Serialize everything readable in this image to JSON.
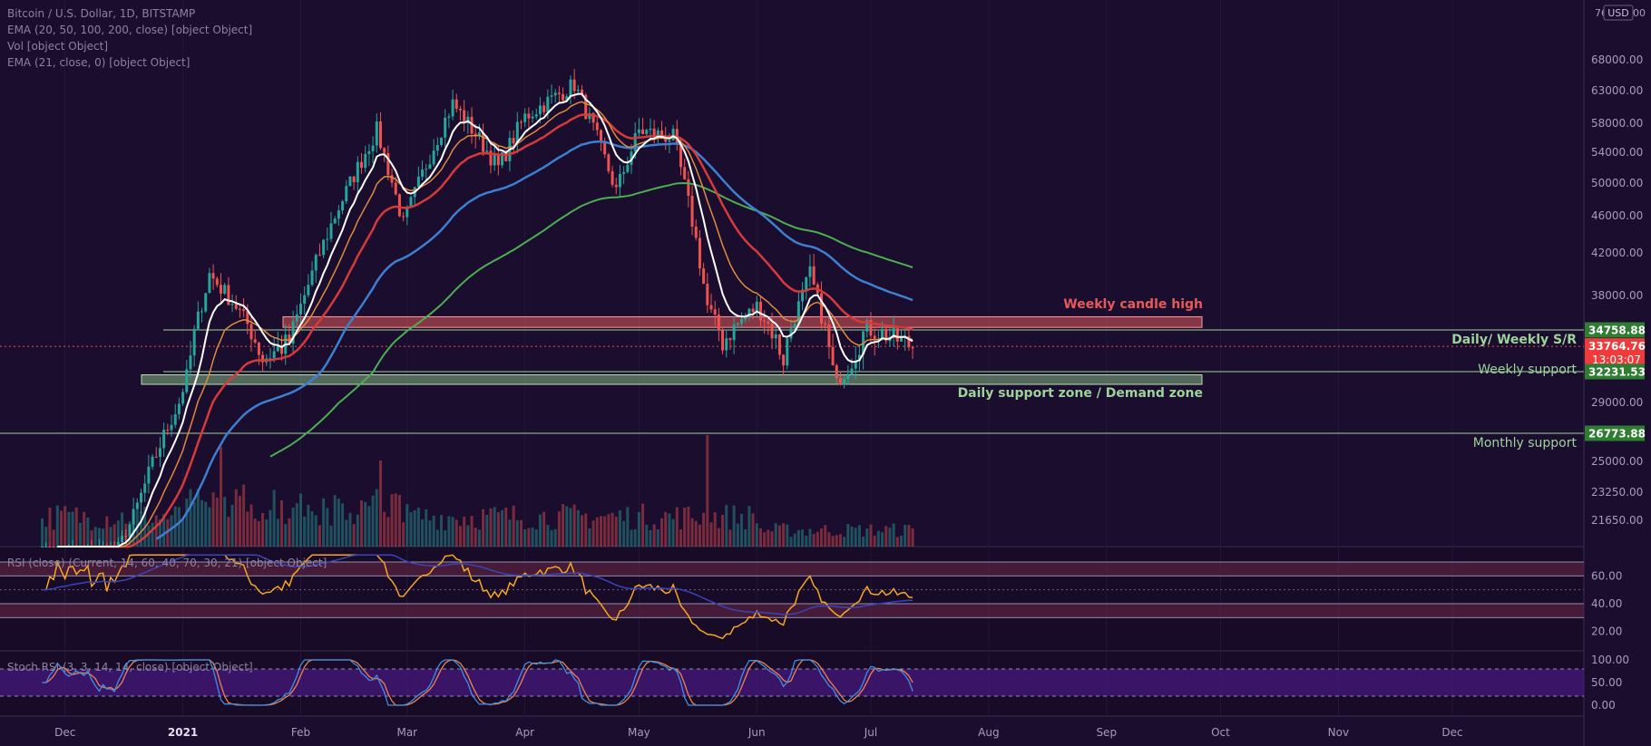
{
  "header": {
    "symbol_line": "Bitcoin / U.S. Dollar, 1D, BITSTAMP",
    "ema_line": "EMA (20, 50, 100, 200, close) [object Object]",
    "vol_line": "Vol [object Object]",
    "ema2_line": "EMA (21, close, 0) [object Object]",
    "rsi_line": "RSI (close) (Current, 14, 60, 40, 70, 30, 21) [object Object]",
    "stoch_line": "Stoch RSI (3, 3, 14, 14, close) [object Object]"
  },
  "currency": "USD",
  "price_axis": {
    "ticks": [
      "68000.00",
      "63000.00",
      "58000.00",
      "54000.00",
      "50000.00",
      "46000.00",
      "42000.00",
      "38000.00",
      "34758.88",
      "33764.76",
      "32231.53",
      "29000.00",
      "26773.88",
      "25000.00",
      "23250.00",
      "21650.00"
    ],
    "top_partial": "76 000.00"
  },
  "rsi_axis": {
    "ticks": [
      "60.00",
      "40.00",
      "20.00"
    ]
  },
  "stoch_axis": {
    "ticks": [
      "100.00",
      "50.00",
      "0.00"
    ]
  },
  "time_axis": {
    "ticks": [
      "Dec",
      "2021",
      "Feb",
      "Mar",
      "Apr",
      "May",
      "Jun",
      "Jul",
      "Aug",
      "Sep",
      "Oct",
      "Nov",
      "Dec"
    ]
  },
  "price_labels": {
    "last_price": "33764.76",
    "countdown": "13:03:07",
    "sr_level": "34758.88",
    "weekly_support": "32231.53",
    "monthly_support": "26773.88"
  },
  "annotations": {
    "weekly_candle_high": "Weekly candle high",
    "daily_weekly_sr": "Daily/ Weekly S/R",
    "weekly_support": "Weekly support",
    "daily_support_zone": "Daily support zone / Demand zone",
    "monthly_support": "Monthly support"
  },
  "colors": {
    "background": "#1a0d2e",
    "bull_candle": "#26a69a",
    "bear_candle": "#ef5350",
    "ema20": "#ffffff",
    "ema50": "#e08a3c",
    "ema100": "#d63a3a",
    "ema200": "#3d7fd0",
    "ema_long": "#4caf50",
    "weekly_candle_high_zone": "#e05a5a",
    "support_zone": "#8ec58a",
    "rsi_line": "#f5a623",
    "stoch_k": "#3d8fe0",
    "stoch_d": "#f0804a"
  },
  "chart_data": {
    "type": "candlestick",
    "x_range": [
      "Nov 2020",
      "Dec 2021"
    ],
    "ylim": [
      19500,
      76000
    ],
    "levels": {
      "weekly_candle_high_zone": [
        35000,
        36000
      ],
      "sr_level": 34758.88,
      "last_price": 33764.76,
      "weekly_support": 32231.53,
      "demand_zone": [
        30900,
        31900
      ],
      "monthly_support": 26773.88
    },
    "price_path": [
      {
        "date": "2020-11-25",
        "close": 19000
      },
      {
        "date": "2020-12-15",
        "close": 19500
      },
      {
        "date": "2020-12-31",
        "close": 29000
      },
      {
        "date": "2021-01-08",
        "close": 40000
      },
      {
        "date": "2021-01-15",
        "close": 37000
      },
      {
        "date": "2021-01-22",
        "close": 33000
      },
      {
        "date": "2021-01-29",
        "close": 34000
      },
      {
        "date": "2021-02-08",
        "close": 44000
      },
      {
        "date": "2021-02-21",
        "close": 57000
      },
      {
        "date": "2021-02-28",
        "close": 45000
      },
      {
        "date": "2021-03-13",
        "close": 61000
      },
      {
        "date": "2021-03-25",
        "close": 52000
      },
      {
        "date": "2021-04-01",
        "close": 59000
      },
      {
        "date": "2021-04-14",
        "close": 64000
      },
      {
        "date": "2021-04-25",
        "close": 49000
      },
      {
        "date": "2021-05-01",
        "close": 57000
      },
      {
        "date": "2021-05-10",
        "close": 56000
      },
      {
        "date": "2021-05-19",
        "close": 37000
      },
      {
        "date": "2021-05-23",
        "close": 34000
      },
      {
        "date": "2021-06-01",
        "close": 37000
      },
      {
        "date": "2021-06-08",
        "close": 33000
      },
      {
        "date": "2021-06-15",
        "close": 40000
      },
      {
        "date": "2021-06-22",
        "close": 31000
      },
      {
        "date": "2021-06-30",
        "close": 35000
      },
      {
        "date": "2021-07-12",
        "close": 33764
      }
    ],
    "rsi": {
      "overbought": 60,
      "oversold": 40,
      "upper_band": 70,
      "lower_band": 30,
      "last": 47
    },
    "stoch_rsi": {
      "upper": 80,
      "lower": 20
    }
  }
}
